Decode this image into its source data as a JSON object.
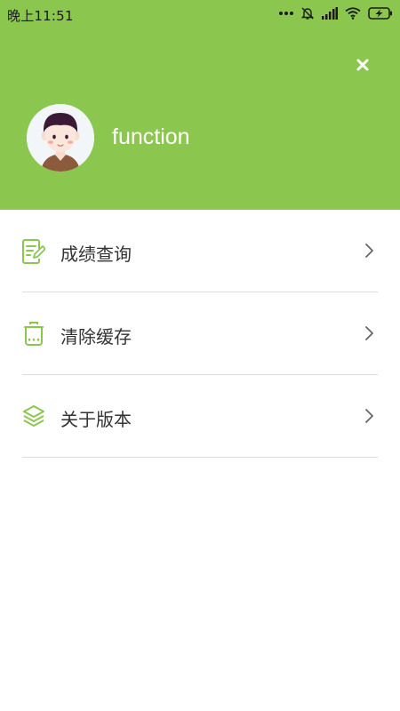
{
  "status_bar": {
    "time": "晚上11:51",
    "icons": [
      "more-dots-icon",
      "mute-bell-icon",
      "signal-icon",
      "wifi-icon",
      "battery-charging-icon"
    ]
  },
  "header": {
    "background": "#8bc74e",
    "close_icon": "close-icon",
    "avatar_icon": "user-avatar",
    "username": "function"
  },
  "menu": {
    "accent": "#8bc74e",
    "items": [
      {
        "label": "成绩查询",
        "icon": "grade-query-icon"
      },
      {
        "label": "清除缓存",
        "icon": "trash-icon"
      },
      {
        "label": "关于版本",
        "icon": "layers-icon"
      }
    ]
  }
}
